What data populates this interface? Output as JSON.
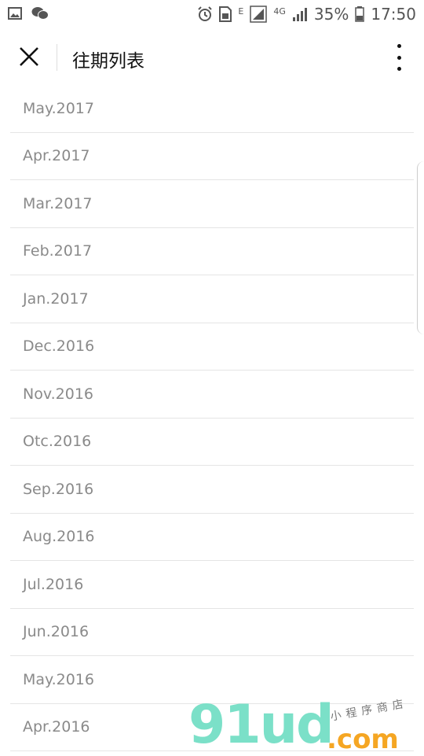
{
  "status_bar": {
    "network": "4G",
    "carrier_letter": "E",
    "battery": "35%",
    "time": "17:50"
  },
  "header": {
    "title": "往期列表"
  },
  "issues": [
    {
      "label": "May.2017"
    },
    {
      "label": "Apr.2017"
    },
    {
      "label": "Mar.2017"
    },
    {
      "label": "Feb.2017"
    },
    {
      "label": "Jan.2017"
    },
    {
      "label": "Dec.2016"
    },
    {
      "label": "Nov.2016"
    },
    {
      "label": "Otc.2016"
    },
    {
      "label": "Sep.2016"
    },
    {
      "label": "Aug.2016"
    },
    {
      "label": "Jul.2016"
    },
    {
      "label": "Jun.2016"
    },
    {
      "label": "May.2016"
    },
    {
      "label": "Apr.2016"
    }
  ],
  "watermark": {
    "brand": "91ud",
    "domain": ".com",
    "tagline": "小程序商店"
  },
  "icons": {
    "close": "close-icon",
    "more": "more-vertical-icon",
    "alarm": "alarm-icon",
    "gallery": "image-icon",
    "wechat": "wechat-icon",
    "sim": "sim-card-icon",
    "signal": "signal-icon",
    "battery": "battery-icon"
  },
  "colors": {
    "item_text": "#8a8a8a",
    "divider": "#e5e5e5",
    "title": "#111111",
    "watermark_main": "#7be0c8",
    "watermark_domain": "#f5a623"
  }
}
